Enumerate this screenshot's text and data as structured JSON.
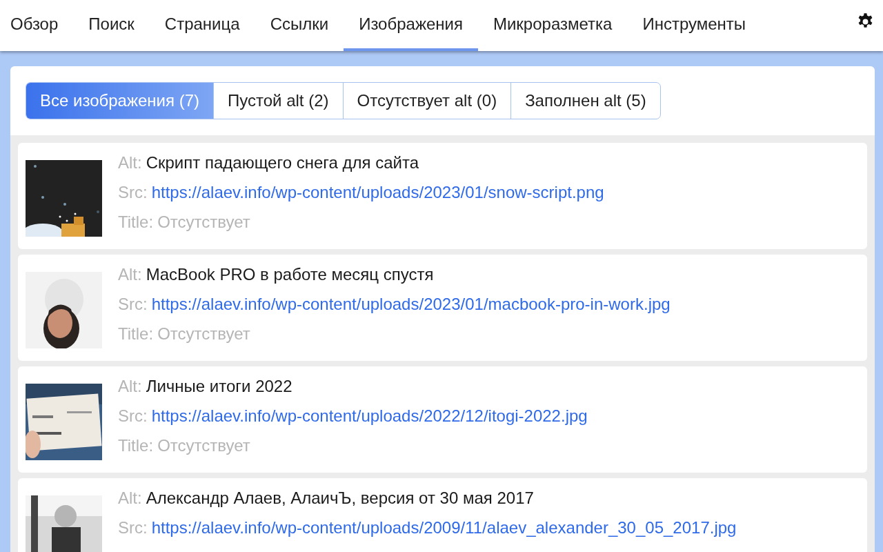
{
  "nav": {
    "tabs": [
      {
        "label": "Обзор",
        "selected": false
      },
      {
        "label": "Поиск",
        "selected": false
      },
      {
        "label": "Страница",
        "selected": false
      },
      {
        "label": "Ссылки",
        "selected": false
      },
      {
        "label": "Изображения",
        "selected": true
      },
      {
        "label": "Микроразметка",
        "selected": false
      },
      {
        "label": "Инструменты",
        "selected": false
      }
    ]
  },
  "filters": [
    {
      "label": "Все изображения (7)",
      "selected": true
    },
    {
      "label": "Пустой alt (2)",
      "selected": false
    },
    {
      "label": "Отсутствует alt (0)",
      "selected": false
    },
    {
      "label": "Заполнен alt (5)",
      "selected": false
    }
  ],
  "images": [
    {
      "alt_label": "Alt:",
      "alt": "Скрипт падающего снега для сайта",
      "src_label": "Src:",
      "src": "https://alaev.info/wp-content/uploads/2023/01/snow-script.png",
      "title_label": "Title:",
      "title": "Отсутствует"
    },
    {
      "alt_label": "Alt:",
      "alt": "MacBook PRO в работе месяц спустя",
      "src_label": "Src:",
      "src": "https://alaev.info/wp-content/uploads/2023/01/macbook-pro-in-work.jpg",
      "title_label": "Title:",
      "title": "Отсутствует"
    },
    {
      "alt_label": "Alt:",
      "alt": "Личные итоги 2022",
      "src_label": "Src:",
      "src": "https://alaev.info/wp-content/uploads/2022/12/itogi-2022.jpg",
      "title_label": "Title:",
      "title": "Отсутствует"
    },
    {
      "alt_label": "Alt:",
      "alt": "Александр Алаев, АлаичЪ, версия от 30 мая 2017",
      "src_label": "Src:",
      "src": "https://alaev.info/wp-content/uploads/2009/11/alaev_alexander_30_05_2017.jpg"
    }
  ]
}
